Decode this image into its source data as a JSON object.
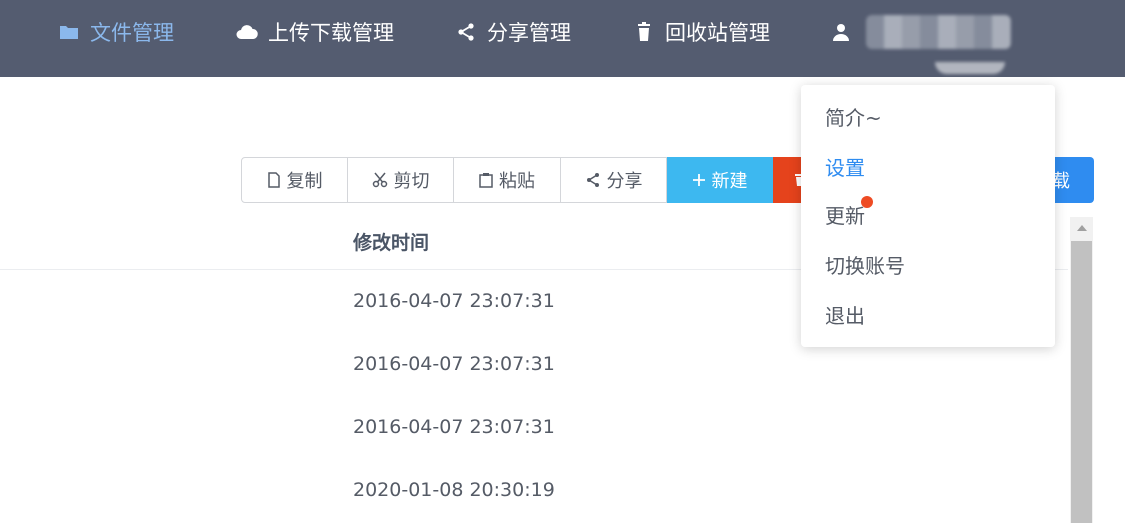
{
  "nav": {
    "files": "文件管理",
    "upload_download": "上传下载管理",
    "share": "分享管理",
    "recycle_bin": "回收站管理"
  },
  "toolbar": {
    "copy": "复制",
    "cut": "剪切",
    "paste": "粘贴",
    "share": "分享",
    "new": "新建",
    "download_partial": "载"
  },
  "table": {
    "column_modified": "修改时间",
    "rows": [
      "2016-04-07 23:07:31",
      "2016-04-07 23:07:31",
      "2016-04-07 23:07:31",
      "2020-01-08 20:30:19"
    ]
  },
  "user_menu": {
    "items": [
      "简介~",
      "设置",
      "更新",
      "切换账号",
      "退出"
    ],
    "active_index": 1,
    "badge_on": "更新"
  },
  "colors": {
    "nav_bg": "#545c70",
    "nav_active": "#8bb8ec",
    "primary_blue": "#2f8cf0",
    "new_button": "#3db8f0",
    "delete_button": "#e5431c",
    "badge": "#ee4b23"
  },
  "icons": {
    "files": "folder-icon",
    "upload_download": "cloud-icon",
    "share": "share-icon",
    "recycle_bin": "trash-icon",
    "user": "user-icon"
  }
}
